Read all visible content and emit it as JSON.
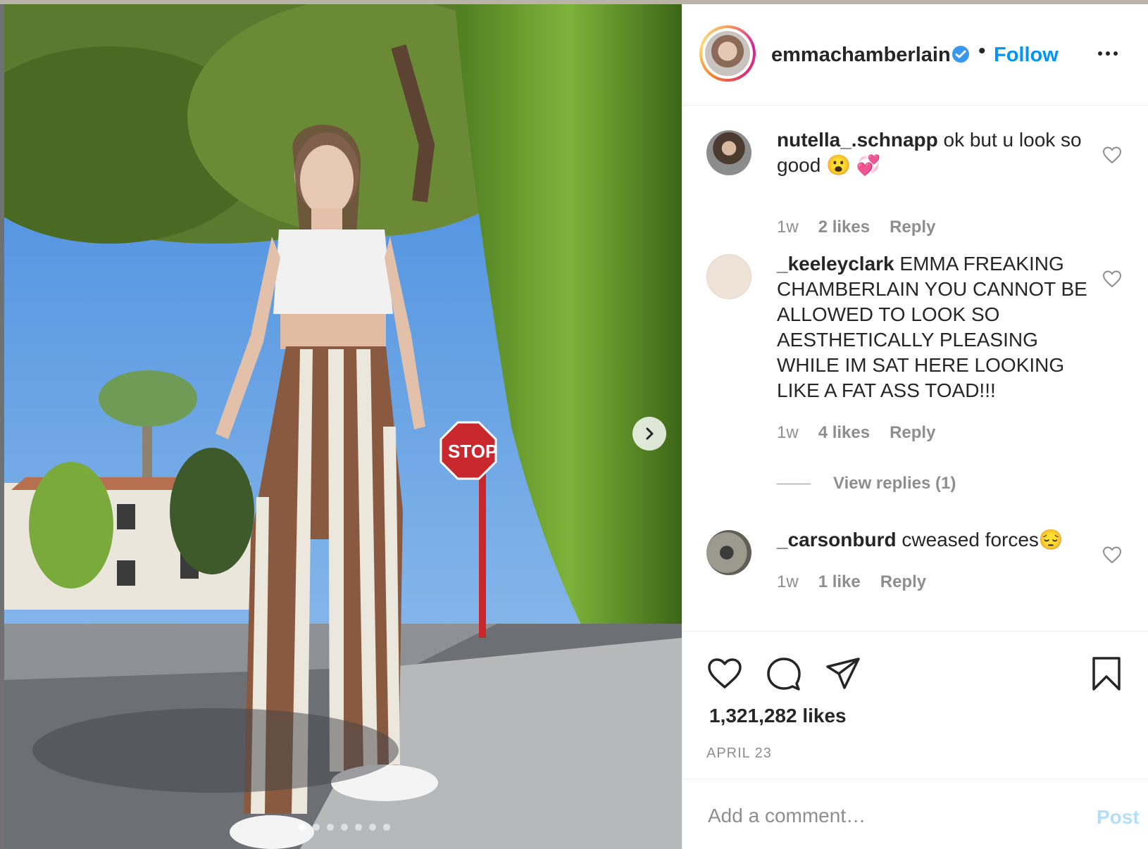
{
  "post": {
    "author": "emmachamberlain",
    "follow_label": "Follow",
    "bullet": "•"
  },
  "carousel": {
    "slide_count": 7,
    "active_index": 0
  },
  "comments": [
    {
      "username": "nutella_.schnapp",
      "text": "ok but u look so good 😮 💞",
      "age": "1w",
      "likes": "2 likes",
      "reply_label": "Reply"
    },
    {
      "username": "_keeleyclark",
      "text": "EMMA FREAKING CHAMBERLAIN YOU CANNOT BE ALLOWED TO LOOK SO AESTHETICALLY PLEASING WHILE IM SAT HERE LOOKING LIKE A FAT ASS TOAD!!!",
      "age": "1w",
      "likes": "4 likes",
      "reply_label": "Reply",
      "view_replies": "View replies (1)"
    },
    {
      "username": "_carsonburd",
      "text": "cweased forces😔",
      "age": "1w",
      "likes": "1 like",
      "reply_label": "Reply"
    }
  ],
  "stats": {
    "likes": "1,321,282 likes",
    "date": "APRIL 23"
  },
  "composer": {
    "placeholder": "Add a comment…",
    "post_label": "Post"
  },
  "colors": {
    "accent": "#0095f6",
    "muted": "#8e8e8e",
    "text": "#262626",
    "post_disabled": "#b2dffc"
  },
  "icons": {
    "verified": "verified-badge-icon",
    "more": "more-options-icon",
    "next": "chevron-right-icon",
    "like": "heart-icon",
    "comment": "comment-bubble-icon",
    "share": "paper-plane-icon",
    "save": "bookmark-icon"
  }
}
